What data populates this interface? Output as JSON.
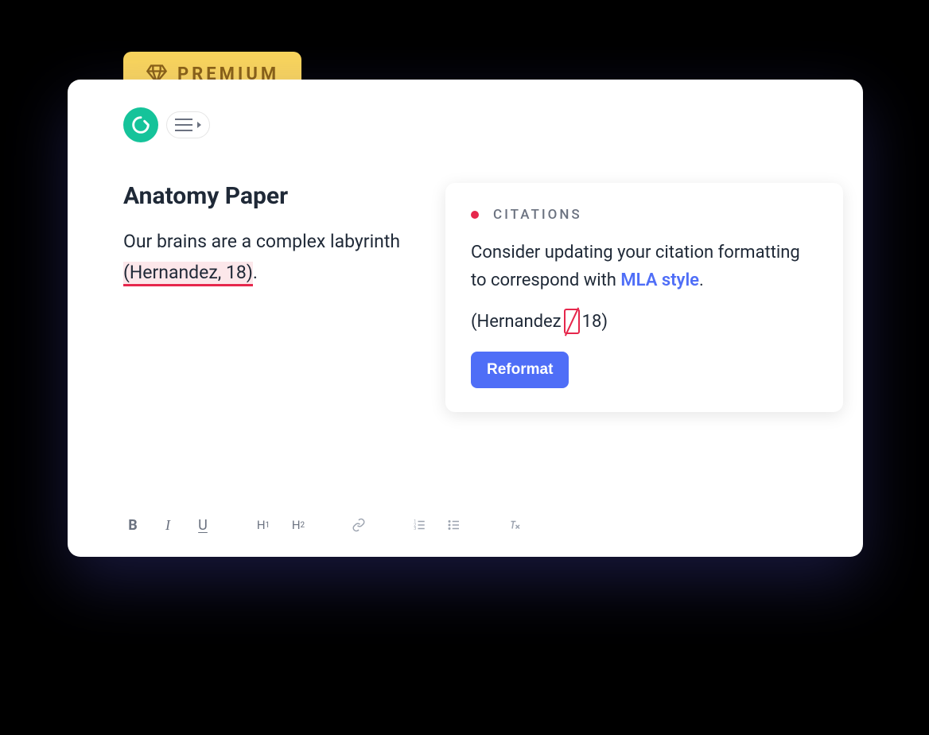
{
  "premium": {
    "label": "PREMIUM"
  },
  "document": {
    "title": "Anatomy Paper",
    "text_before": "Our brains are a complex labyrinth ",
    "highlighted": "(Hernandez, 18)",
    "text_after": "."
  },
  "suggestion": {
    "category": "CITATIONS",
    "message_before": "Consider updating your citation formatting to correspond with ",
    "link": "MLA style",
    "message_after": ".",
    "example_before": "(Hernandez",
    "correction_char": ",",
    "example_after": "18)",
    "button": "Reformat"
  },
  "toolbar": {
    "bold": "B",
    "italic": "I",
    "underline": "U",
    "h1": "H",
    "h1_sub": "1",
    "h2": "H",
    "h2_sub": "2"
  }
}
